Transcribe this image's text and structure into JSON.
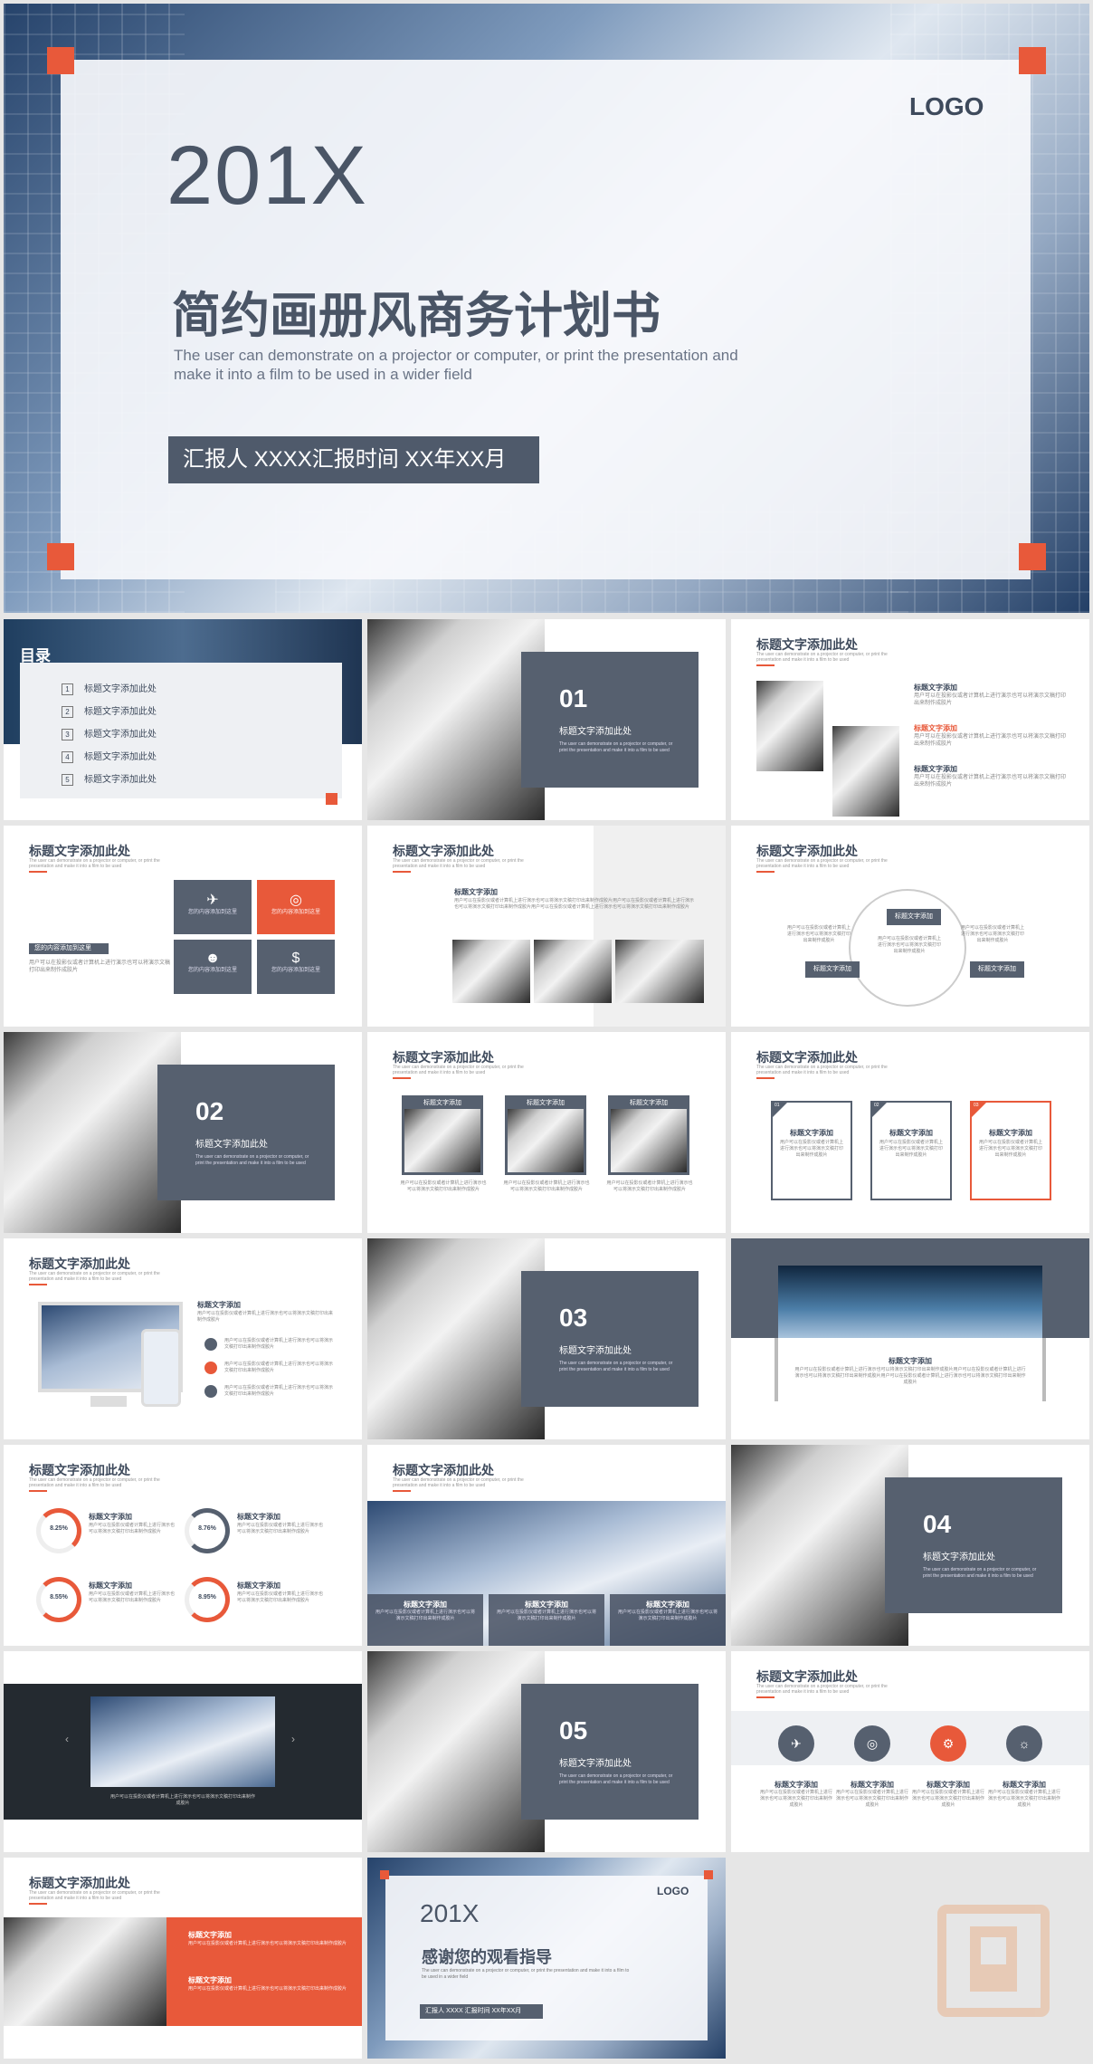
{
  "cover": {
    "year": "201X",
    "logo": "LOGO",
    "title": "简约画册风商务计划书",
    "subtitle_line1": "The user can demonstrate on a projector or computer, or print the presentation and",
    "subtitle_line2": "make it into a film to be used in a wider field",
    "reporter": "汇报人 XXXX汇报时间 XX年XX月"
  },
  "toc": {
    "heading": "目录",
    "items": [
      {
        "num": "1",
        "label": "标题文字添加此处"
      },
      {
        "num": "2",
        "label": "标题文字添加此处"
      },
      {
        "num": "3",
        "label": "标题文字添加此处"
      },
      {
        "num": "4",
        "label": "标题文字添加此处"
      },
      {
        "num": "5",
        "label": "标题文字添加此处"
      }
    ]
  },
  "common": {
    "slide_title": "标题文字添加此处",
    "slide_sub": "The user can demonstrate on a projector or computer, or print the presentation and make it into a film to be used",
    "item_title": "标题文字添加",
    "item_text": "用户可以在投影仪或者计算机上进行演示也可以将演示文稿打印出来制作成胶片",
    "section_title": "标题文字添加此处",
    "section_desc": "The user can demonstrate on a projector or computer, or print the presentation and make it into a film to be used"
  },
  "sections": [
    "01",
    "02",
    "03",
    "04",
    "05"
  ],
  "icons_slide": {
    "left_label": "您的内容添加到这里",
    "tile_label": "您的内容添加到这里"
  },
  "cycle_slide": {
    "label": "标题文字添加"
  },
  "donuts": [
    "8.25%",
    "8.76%",
    "8.55%",
    "8.95%"
  ],
  "cards": [
    "01",
    "02",
    "03"
  ],
  "ending": {
    "year": "201X",
    "logo": "LOGO",
    "title": "感谢您的观看指导",
    "sub": "The user can demonstrate on a projector or computer, or print the presentation and make it into a film to be used in a wider field",
    "reporter": "汇报人 XXXX 汇报时间 XX年XX月"
  },
  "colors": {
    "navy": "#56606f",
    "orange": "#e8593a",
    "text": "#3e4a5c"
  }
}
